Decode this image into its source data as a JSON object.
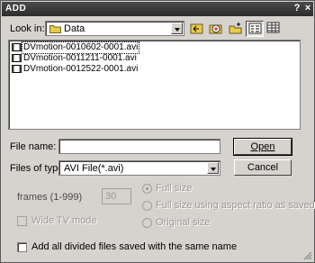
{
  "window": {
    "title": "ADD",
    "help_glyph": "?",
    "close_glyph": "×"
  },
  "look_in": {
    "label": "Look in:",
    "value": "Data",
    "icon": "folder-icon"
  },
  "toolbar": {
    "icons": [
      "back-icon",
      "up-folder-icon",
      "new-folder-icon",
      "list-view-icon",
      "details-view-icon"
    ]
  },
  "files": [
    {
      "name": "DVmotion-0010602-0001.avi",
      "icon": "video-file-icon",
      "selected": true
    },
    {
      "name": "DVmotion-0011211-0001.avi",
      "icon": "video-file-icon",
      "selected": false
    },
    {
      "name": "DVmotion-0012522-0001.avi",
      "icon": "video-file-icon",
      "selected": false
    }
  ],
  "file_name": {
    "label": "File name:",
    "value": ""
  },
  "file_type": {
    "label": "Files of type:",
    "value": "AVI File(*.avi)"
  },
  "buttons": {
    "open": "Open",
    "cancel": "Cancel"
  },
  "frames": {
    "label": "frames (1-999)",
    "value": "30"
  },
  "wide_tv": {
    "label": "Wide TV mode",
    "enabled": false,
    "checked": false
  },
  "size_options": [
    {
      "label": "Full size",
      "selected": true,
      "enabled": false
    },
    {
      "label": "Full size using aspect ratio as saved",
      "selected": false,
      "enabled": false
    },
    {
      "label": "Original size",
      "selected": false,
      "enabled": false
    }
  ],
  "add_all": {
    "label": "Add all divided files saved with the same name",
    "checked": false
  },
  "colors": {
    "titlebar": "#3a3a3a",
    "dialog_bg": "#d6d3ce",
    "disabled_text": "#9a9894",
    "folder": "#e8c94a"
  }
}
